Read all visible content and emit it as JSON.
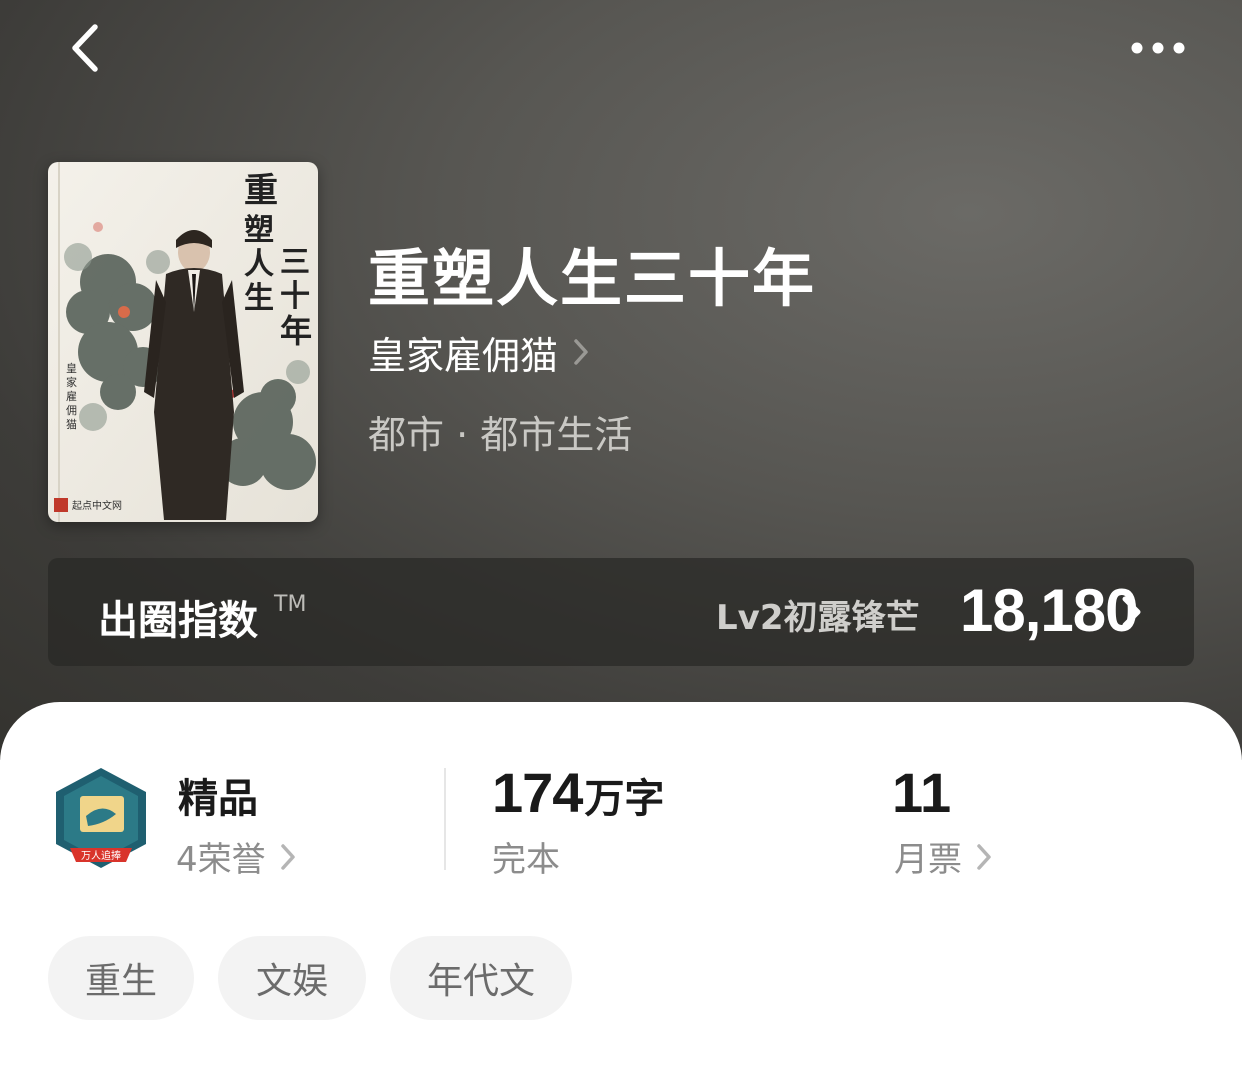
{
  "book": {
    "title": "重塑人生三十年",
    "author": "皇家雇佣猫",
    "category": "都市 · 都市生活",
    "cover": {
      "title_col1": "重塑人生",
      "title_col2": "三十年",
      "author_vertical": "皇家雇佣猫",
      "publisher": "起点中文网"
    }
  },
  "index": {
    "label": "出圈指数",
    "tm": "TM",
    "level": "Lv2初露锋芒",
    "score": "18,180"
  },
  "stats": {
    "quality": {
      "title": "精品",
      "honors": "4荣誉",
      "badge_text": "万人追捧"
    },
    "words": {
      "number": "174",
      "unit": "万字",
      "status": "完本"
    },
    "tickets": {
      "number": "11",
      "label": "月票"
    }
  },
  "tags": [
    "重生",
    "文娱",
    "年代文"
  ],
  "icons": {
    "back": "chevron-left-icon",
    "more": "more-dots-icon",
    "chevron": "chevron-right-icon"
  },
  "colors": {
    "hero_bg": "#4a4945",
    "sheet_bg": "#ffffff",
    "tag_bg": "#f3f3f3",
    "badge_red": "#d9342b",
    "badge_teal": "#1f5f70"
  }
}
